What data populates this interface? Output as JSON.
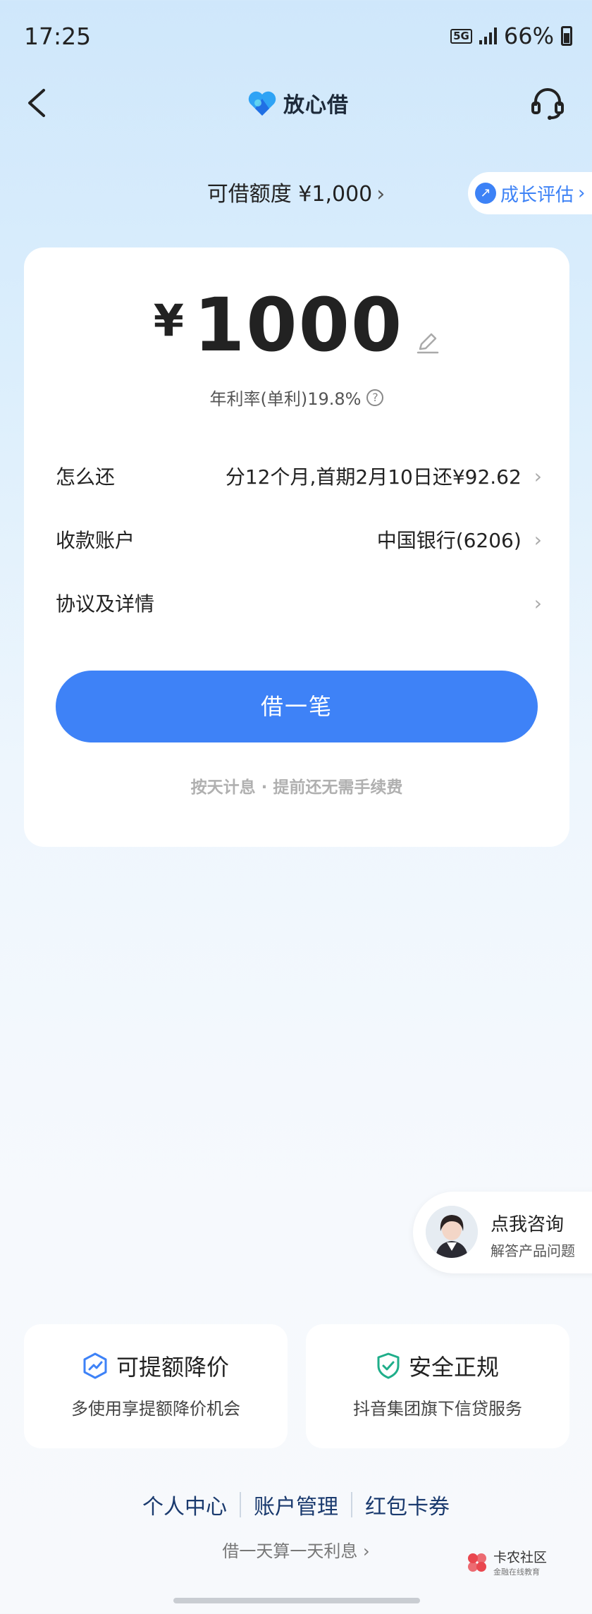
{
  "status_bar": {
    "time": "17:25",
    "network": "5G",
    "battery": "66%"
  },
  "nav": {
    "brand": "放心借"
  },
  "credit": {
    "label": "可借额度 ¥1,000",
    "growth_label": "成长评估"
  },
  "loan": {
    "currency": "¥",
    "amount": "1000",
    "rate_text": "年利率(单利)19.8%",
    "rows": [
      {
        "label": "怎么还",
        "value": "分12个月,首期2月10日还¥92.62"
      },
      {
        "label": "收款账户",
        "value": "中国银行(6206)"
      },
      {
        "label": "协议及详情",
        "value": ""
      }
    ],
    "button": "借一笔",
    "note": "按天计息 · 提前还无需手续费"
  },
  "consult": {
    "title": "点我咨询",
    "subtitle": "解答产品问题"
  },
  "features": [
    {
      "title": "可提额降价",
      "subtitle": "多使用享提额降价机会"
    },
    {
      "title": "安全正规",
      "subtitle": "抖音集团旗下信贷服务"
    }
  ],
  "links": [
    "个人中心",
    "账户管理",
    "红包卡券"
  ],
  "daily_note": "借一天算一天利息",
  "watermark": {
    "title": "卡农社区",
    "subtitle": "金融在线教育"
  },
  "colors": {
    "accent": "#3e82f7",
    "shield": "#1fae8a"
  }
}
